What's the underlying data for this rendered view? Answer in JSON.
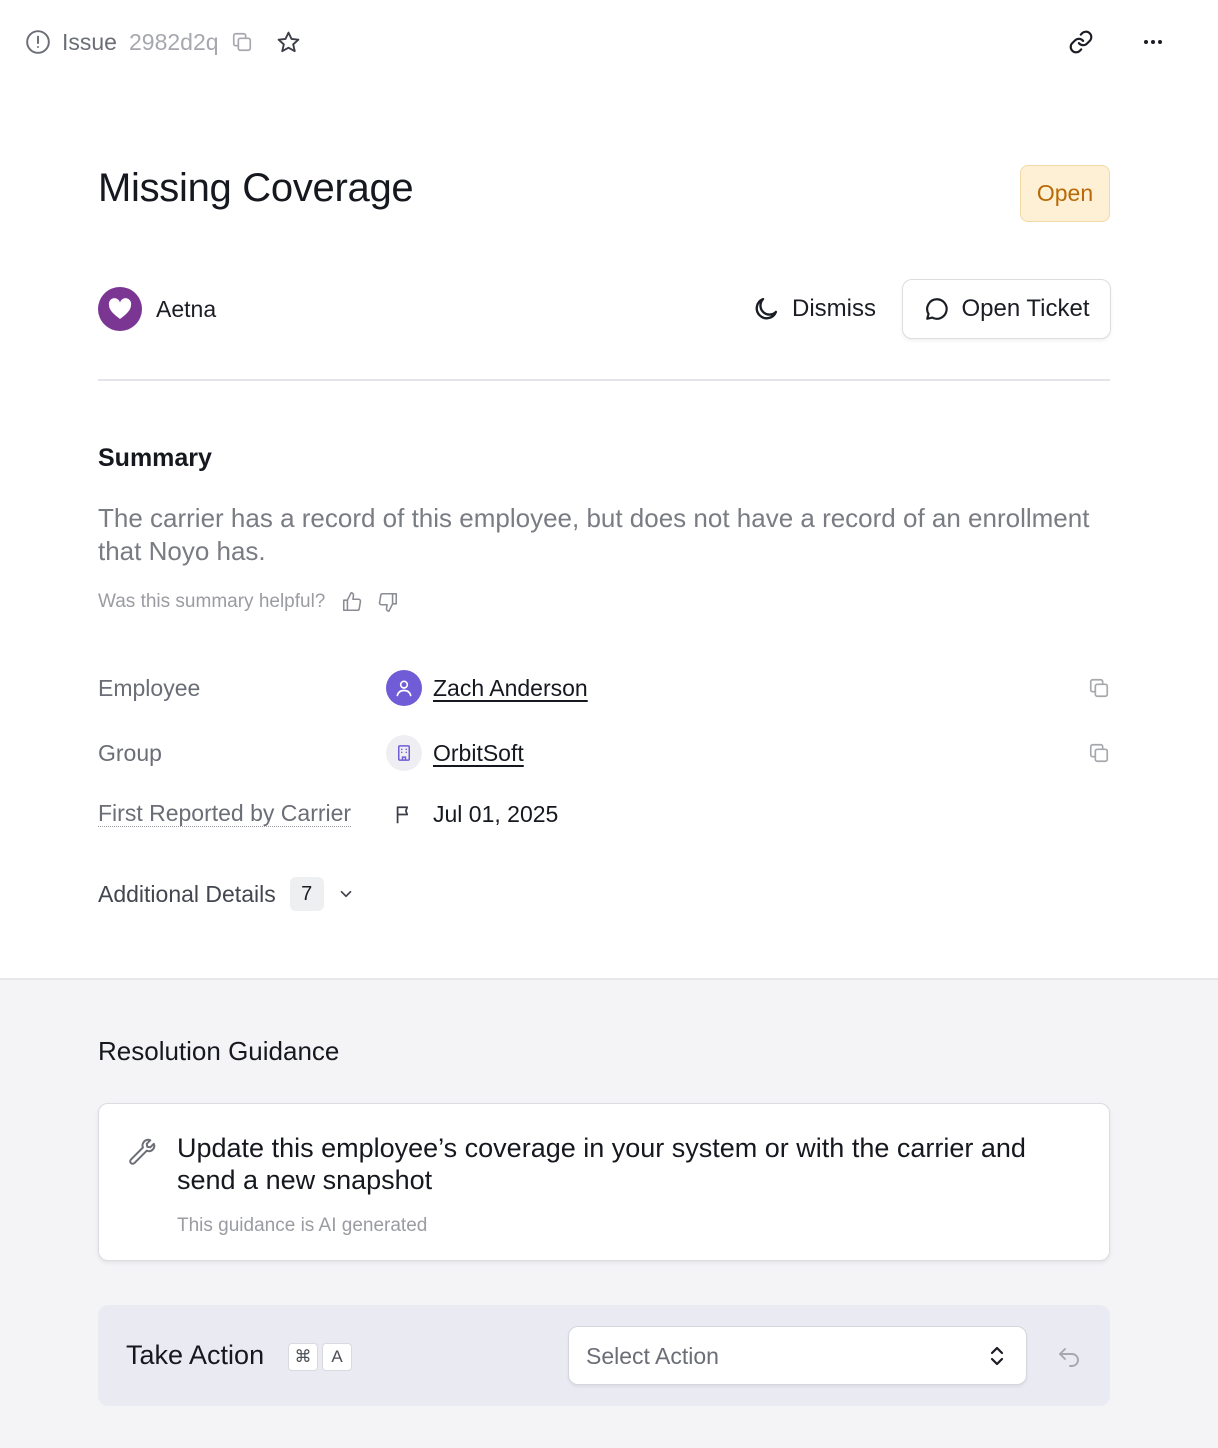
{
  "header": {
    "issue_label": "Issue",
    "issue_id": "2982d2q"
  },
  "issue": {
    "title": "Missing Coverage",
    "status": "Open",
    "status_color": "#b96a07"
  },
  "carrier": {
    "name": "Aetna",
    "brand_color": "#7b3593"
  },
  "actions": {
    "dismiss_label": "Dismiss",
    "open_ticket_label": "Open Ticket"
  },
  "summary": {
    "heading": "Summary",
    "text": "The carrier has a record of this employee, but does not have a record of an enrollment that Noyo has.",
    "helpful_prompt": "Was this summary helpful?"
  },
  "fields": {
    "employee_label": "Employee",
    "employee_value": "Zach Anderson",
    "group_label": "Group",
    "group_value": "OrbitSoft",
    "first_reported_label": "First Reported by Carrier",
    "first_reported_value": "Jul 01, 2025"
  },
  "additional_details": {
    "label": "Additional Details",
    "count": "7"
  },
  "resolution": {
    "heading": "Resolution Guidance",
    "guidance": "Update this employee’s coverage in your system or with the carrier and send a new snapshot",
    "note": "This guidance is AI generated"
  },
  "take_action": {
    "label": "Take Action",
    "shortcut_keys": [
      "⌘",
      "A"
    ],
    "select_placeholder": "Select Action"
  },
  "icons": [
    "alert-circle-icon",
    "copy-icon",
    "star-icon",
    "link-icon",
    "more-icon",
    "heart-icon",
    "moon-icon",
    "chat-icon",
    "thumbs-up-icon",
    "thumbs-down-icon",
    "user-icon",
    "building-icon",
    "flag-icon",
    "chevron-down-icon",
    "wrench-icon",
    "chevron-up-down-icon",
    "undo-icon"
  ]
}
